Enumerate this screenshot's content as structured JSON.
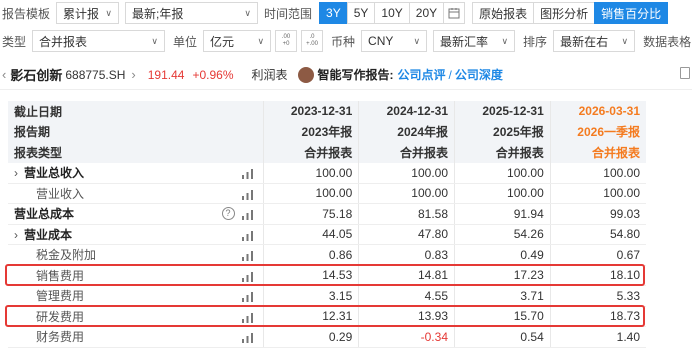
{
  "toolbar1": {
    "report_template_label": "报告模板",
    "template_value": "累计报",
    "period_value": "最新;年报",
    "time_range_label": "时间范围",
    "ranges": [
      "3Y",
      "5Y",
      "10Y",
      "20Y"
    ],
    "active_range": "3Y",
    "views": [
      "原始报表",
      "图形分析",
      "销售百分比"
    ],
    "active_view": "销售百分比"
  },
  "toolbar2": {
    "type_label": "类型",
    "type_value": "合并报表",
    "unit_label": "单位",
    "unit_value": "亿元",
    "decimal_up": ".00 +0",
    "decimal_down": ".0 +.00",
    "currency_label": "币种",
    "currency_value": "CNY",
    "rate_value": "最新汇率",
    "sort_label": "排序",
    "sort_value": "最新在右",
    "table_label": "数据表格"
  },
  "stock": {
    "name": "影石创新",
    "code": "688775.SH",
    "price": "191.44",
    "change": "+0.96%",
    "statement": "利润表",
    "ai_label": "智能写作报告:",
    "link1": "公司点评",
    "sep": "/",
    "link2": "公司深度"
  },
  "table": {
    "header_rows": [
      {
        "label": "截止日期",
        "cols": [
          "2023-12-31",
          "2024-12-31",
          "2025-12-31",
          "2026-03-31"
        ]
      },
      {
        "label": "报告期",
        "cols": [
          "2023年报",
          "2024年报",
          "2025年报",
          "2026一季报"
        ]
      },
      {
        "label": "报表类型",
        "cols": [
          "合并报表",
          "合并报表",
          "合并报表",
          "合并报表"
        ]
      }
    ],
    "rows": [
      {
        "label": "营业总收入",
        "expander": "›",
        "indent": 1,
        "values": [
          "100.00",
          "100.00",
          "100.00",
          "100.00"
        ]
      },
      {
        "label": "营业收入",
        "expander": "",
        "indent": 2,
        "values": [
          "100.00",
          "100.00",
          "100.00",
          "100.00"
        ]
      },
      {
        "label": "营业总成本",
        "expander": "",
        "indent": 0,
        "values": [
          "75.18",
          "81.58",
          "91.94",
          "99.03"
        ],
        "help": "?"
      },
      {
        "label": "营业成本",
        "expander": "›",
        "indent": 1,
        "values": [
          "44.05",
          "47.80",
          "54.26",
          "54.80"
        ]
      },
      {
        "label": "税金及附加",
        "expander": "",
        "indent": 2,
        "values": [
          "0.86",
          "0.83",
          "0.49",
          "0.67"
        ]
      },
      {
        "label": "销售费用",
        "expander": "",
        "indent": 2,
        "values": [
          "14.53",
          "14.81",
          "17.23",
          "18.10"
        ]
      },
      {
        "label": "管理费用",
        "expander": "",
        "indent": 2,
        "values": [
          "3.15",
          "4.55",
          "3.71",
          "5.33"
        ]
      },
      {
        "label": "研发费用",
        "expander": "",
        "indent": 2,
        "values": [
          "12.31",
          "13.93",
          "15.70",
          "18.73"
        ]
      },
      {
        "label": "财务费用",
        "expander": "",
        "indent": 2,
        "values": [
          "0.29",
          "-0.34",
          "0.54",
          "1.40"
        ]
      }
    ]
  },
  "colors": {
    "accent": "#1e88e5",
    "up": "#e53935",
    "forecast": "#f47b20",
    "highlight": "#e53935"
  }
}
